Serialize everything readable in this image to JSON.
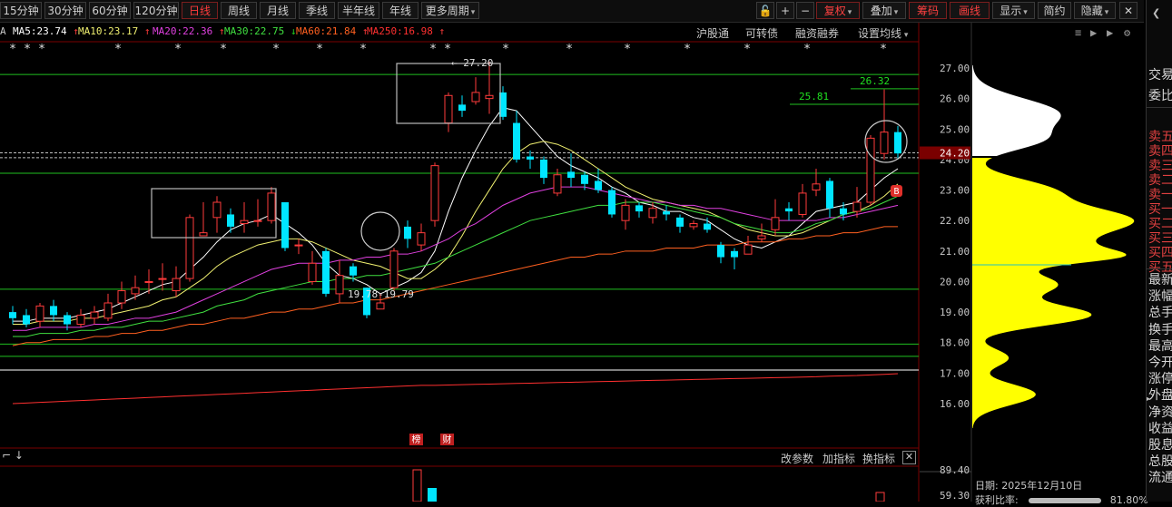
{
  "toolbar": {
    "periods": [
      "15分钟",
      "30分钟",
      "60分钟",
      "120分钟",
      "日线",
      "周线",
      "月线",
      "季线",
      "半年线",
      "年线",
      "更多周期"
    ],
    "active_period": "日线",
    "right_buttons": [
      "复权",
      "叠加",
      "筹码",
      "画线",
      "显示",
      "简约",
      "隐藏"
    ]
  },
  "ma_line": [
    {
      "label": "A",
      "value": "",
      "color": "#c8c8c8"
    },
    {
      "label": "MA5:23.74",
      "arrow": "↑",
      "color": "#ffffff",
      "arrow_color": "#ff3b3b"
    },
    {
      "label": "MA10:23.17",
      "arrow": "↑",
      "color": "#f0f070",
      "arrow_color": "#ff3b3b"
    },
    {
      "label": "MA20:22.36",
      "arrow": "↑",
      "color": "#e040e0",
      "arrow_color": "#ff3b3b"
    },
    {
      "label": "MA30:22.75",
      "arrow": "↓",
      "color": "#40e040",
      "arrow_color": "#20d020"
    },
    {
      "label": "MA60:21.84",
      "arrow": "↑",
      "color": "#ff6020",
      "arrow_color": "#ff3b3b"
    },
    {
      "label": "MA250:16.98",
      "arrow": "↑",
      "color": "#ff3030",
      "arrow_color": "#ff3b3b"
    }
  ],
  "top_links": [
    "沪股通",
    "可转债",
    "融资融券",
    "设置均线"
  ],
  "indicator_links": [
    "改参数",
    "加指标",
    "换指标"
  ],
  "price_axis": [
    "27.00",
    "26.00",
    "25.00",
    "24.00",
    "23.00",
    "22.00",
    "21.00",
    "20.00",
    "19.00",
    "18.00",
    "17.00",
    "16.00"
  ],
  "current_price": "24.20",
  "volume_axis": [
    "89.40",
    "59.30"
  ],
  "annotations": {
    "high_label": "27.20",
    "low_label": "19.78-19.79",
    "level_1": "25.81",
    "level_2": "26.32",
    "badge_b": "B",
    "tag_bang": "榜",
    "tag_cai": "财"
  },
  "side_panel": {
    "top_labels": [
      "交易",
      "委比"
    ],
    "order_labels": [
      "卖五",
      "卖四",
      "卖三",
      "卖二",
      "卖一",
      "买一",
      "买二",
      "买三",
      "买四",
      "买五"
    ],
    "stat_labels": [
      "最新",
      "涨幅",
      "总手",
      "换手",
      "最高",
      "今开",
      "涨停",
      "外盘",
      "净资",
      "收益",
      "股息",
      "总股",
      "流通"
    ]
  },
  "status": {
    "date": "日期: 2025年12月10日",
    "ratio_label": "获利比率:",
    "ratio_value": "81.80%"
  },
  "colors": {
    "up": "#ff3b3b",
    "down": "#00e5ff",
    "accent_red": "#e0302a",
    "grid": "#7a0000"
  },
  "chart_data": {
    "type": "candlestick",
    "ylim": [
      15.0,
      27.5
    ],
    "candles": [
      {
        "o": 19.0,
        "c": 18.8,
        "h": 19.2,
        "l": 18.6
      },
      {
        "o": 18.9,
        "c": 18.6,
        "h": 19.1,
        "l": 18.5
      },
      {
        "o": 18.7,
        "c": 19.2,
        "h": 19.3,
        "l": 18.5
      },
      {
        "o": 19.2,
        "c": 18.9,
        "h": 19.4,
        "l": 18.7
      },
      {
        "o": 18.9,
        "c": 18.6,
        "h": 19.0,
        "l": 18.4
      },
      {
        "o": 18.6,
        "c": 18.9,
        "h": 19.1,
        "l": 18.5
      },
      {
        "o": 18.8,
        "c": 19.0,
        "h": 19.2,
        "l": 18.6
      },
      {
        "o": 18.8,
        "c": 19.3,
        "h": 19.6,
        "l": 18.7
      },
      {
        "o": 19.3,
        "c": 19.7,
        "h": 20.0,
        "l": 19.1
      },
      {
        "o": 19.6,
        "c": 19.8,
        "h": 20.2,
        "l": 19.4
      },
      {
        "o": 20.0,
        "c": 20.0,
        "h": 20.4,
        "l": 19.6
      },
      {
        "o": 20.1,
        "c": 20.1,
        "h": 20.6,
        "l": 19.7
      },
      {
        "o": 19.7,
        "c": 20.1,
        "h": 20.5,
        "l": 19.5
      },
      {
        "o": 20.1,
        "c": 22.1,
        "h": 22.2,
        "l": 20.0
      },
      {
        "o": 21.5,
        "c": 21.6,
        "h": 22.6,
        "l": 21.5
      },
      {
        "o": 22.1,
        "c": 22.6,
        "h": 22.8,
        "l": 21.6
      },
      {
        "o": 22.2,
        "c": 21.8,
        "h": 22.4,
        "l": 21.6
      },
      {
        "o": 21.9,
        "c": 22.0,
        "h": 22.6,
        "l": 21.6
      },
      {
        "o": 22.0,
        "c": 22.0,
        "h": 22.7,
        "l": 21.8
      },
      {
        "o": 22.0,
        "c": 22.9,
        "h": 23.1,
        "l": 21.9
      },
      {
        "o": 22.6,
        "c": 21.1,
        "h": 22.6,
        "l": 21.0
      },
      {
        "o": 21.2,
        "c": 21.2,
        "h": 21.4,
        "l": 20.9
      },
      {
        "o": 20.0,
        "c": 20.6,
        "h": 21.0,
        "l": 19.9
      },
      {
        "o": 21.0,
        "c": 19.6,
        "h": 21.1,
        "l": 19.5
      },
      {
        "o": 19.6,
        "c": 20.2,
        "h": 20.7,
        "l": 19.3
      },
      {
        "o": 20.5,
        "c": 20.2,
        "h": 20.6,
        "l": 20.0
      },
      {
        "o": 19.8,
        "c": 18.9,
        "h": 19.8,
        "l": 18.8
      },
      {
        "o": 19.1,
        "c": 19.3,
        "h": 19.6,
        "l": 19.1
      },
      {
        "o": 19.8,
        "c": 21.0,
        "h": 21.1,
        "l": 19.7
      },
      {
        "o": 21.8,
        "c": 21.4,
        "h": 22.0,
        "l": 21.1
      },
      {
        "o": 21.2,
        "c": 21.6,
        "h": 21.9,
        "l": 21.0
      },
      {
        "o": 22.0,
        "c": 23.8,
        "h": 23.9,
        "l": 21.8
      },
      {
        "o": 25.2,
        "c": 26.1,
        "h": 26.2,
        "l": 24.9
      },
      {
        "o": 25.8,
        "c": 25.6,
        "h": 26.1,
        "l": 25.4
      },
      {
        "o": 25.9,
        "c": 26.2,
        "h": 26.7,
        "l": 25.8
      },
      {
        "o": 26.0,
        "c": 26.1,
        "h": 27.2,
        "l": 25.5
      },
      {
        "o": 26.2,
        "c": 25.4,
        "h": 26.4,
        "l": 25.3
      },
      {
        "o": 25.2,
        "c": 24.0,
        "h": 25.6,
        "l": 23.9
      },
      {
        "o": 24.1,
        "c": 24.0,
        "h": 24.3,
        "l": 23.7
      },
      {
        "o": 24.0,
        "c": 23.4,
        "h": 24.1,
        "l": 23.2
      },
      {
        "o": 22.9,
        "c": 23.5,
        "h": 23.7,
        "l": 22.8
      },
      {
        "o": 23.6,
        "c": 23.4,
        "h": 24.2,
        "l": 23.1
      },
      {
        "o": 23.5,
        "c": 23.2,
        "h": 23.6,
        "l": 23.0
      },
      {
        "o": 23.3,
        "c": 23.0,
        "h": 23.7,
        "l": 22.9
      },
      {
        "o": 23.0,
        "c": 22.2,
        "h": 23.1,
        "l": 22.1
      },
      {
        "o": 22.0,
        "c": 22.5,
        "h": 22.7,
        "l": 21.7
      },
      {
        "o": 22.5,
        "c": 22.3,
        "h": 22.6,
        "l": 22.1
      },
      {
        "o": 22.1,
        "c": 22.4,
        "h": 22.6,
        "l": 21.9
      },
      {
        "o": 22.3,
        "c": 22.2,
        "h": 22.5,
        "l": 22.0
      },
      {
        "o": 22.1,
        "c": 21.8,
        "h": 22.2,
        "l": 21.6
      },
      {
        "o": 21.8,
        "c": 21.9,
        "h": 22.0,
        "l": 21.7
      },
      {
        "o": 21.9,
        "c": 21.7,
        "h": 22.1,
        "l": 21.6
      },
      {
        "o": 21.2,
        "c": 20.8,
        "h": 21.3,
        "l": 20.6
      },
      {
        "o": 21.0,
        "c": 20.8,
        "h": 21.1,
        "l": 20.4
      },
      {
        "o": 20.9,
        "c": 21.2,
        "h": 21.5,
        "l": 20.9
      },
      {
        "o": 21.4,
        "c": 21.5,
        "h": 21.9,
        "l": 21.3
      },
      {
        "o": 21.7,
        "c": 22.1,
        "h": 22.7,
        "l": 21.5
      },
      {
        "o": 22.4,
        "c": 22.3,
        "h": 22.6,
        "l": 22.0
      },
      {
        "o": 22.2,
        "c": 22.9,
        "h": 23.2,
        "l": 22.1
      },
      {
        "o": 23.0,
        "c": 23.2,
        "h": 23.7,
        "l": 22.8
      },
      {
        "o": 23.3,
        "c": 22.4,
        "h": 23.4,
        "l": 22.1
      },
      {
        "o": 22.4,
        "c": 22.2,
        "h": 22.6,
        "l": 22.0
      },
      {
        "o": 22.3,
        "c": 22.6,
        "h": 23.1,
        "l": 22.1
      },
      {
        "o": 22.6,
        "c": 24.7,
        "h": 24.8,
        "l": 22.5
      },
      {
        "o": 24.2,
        "c": 24.9,
        "h": 26.3,
        "l": 24.0
      },
      {
        "o": 24.9,
        "c": 24.2,
        "h": 25.1,
        "l": 24.0
      }
    ],
    "ma_series": [
      {
        "name": "MA5",
        "color": "#ffffff",
        "values": [
          18.7,
          18.7,
          18.8,
          18.8,
          18.8,
          18.9,
          19.0,
          19.1,
          19.3,
          19.5,
          19.7,
          19.9,
          20.0,
          20.4,
          20.8,
          21.3,
          21.7,
          21.9,
          22.0,
          22.2,
          21.9,
          21.6,
          21.2,
          20.6,
          20.2,
          20.1,
          19.9,
          19.6,
          19.8,
          20.0,
          20.3,
          21.0,
          22.3,
          23.4,
          24.3,
          25.1,
          25.7,
          25.6,
          25.1,
          24.6,
          24.1,
          23.8,
          23.6,
          23.4,
          23.1,
          22.9,
          22.6,
          22.5,
          22.3,
          22.3,
          22.1,
          22.0,
          21.7,
          21.4,
          21.2,
          21.1,
          21.3,
          21.5,
          21.9,
          22.3,
          22.4,
          22.5,
          22.6,
          23.0,
          23.4,
          23.7
        ]
      },
      {
        "name": "MA10",
        "color": "#f0f070",
        "values": [
          18.6,
          18.6,
          18.7,
          18.7,
          18.7,
          18.8,
          18.8,
          18.9,
          19.0,
          19.1,
          19.2,
          19.4,
          19.5,
          19.8,
          20.1,
          20.5,
          20.8,
          21.0,
          21.2,
          21.3,
          21.4,
          21.4,
          21.3,
          21.1,
          20.9,
          20.7,
          20.6,
          20.5,
          20.3,
          20.1,
          20.1,
          20.4,
          20.8,
          21.5,
          22.3,
          23.0,
          23.7,
          24.2,
          24.5,
          24.6,
          24.5,
          24.3,
          24.0,
          23.7,
          23.4,
          23.1,
          22.9,
          22.7,
          22.6,
          22.5,
          22.4,
          22.3,
          22.1,
          21.9,
          21.7,
          21.6,
          21.5,
          21.5,
          21.6,
          21.8,
          22.0,
          22.2,
          22.3,
          22.5,
          22.8,
          23.2
        ]
      },
      {
        "name": "MA20",
        "color": "#e040e0",
        "values": [
          18.4,
          18.4,
          18.5,
          18.5,
          18.5,
          18.5,
          18.6,
          18.6,
          18.7,
          18.8,
          18.8,
          18.9,
          19.0,
          19.2,
          19.4,
          19.6,
          19.8,
          20.0,
          20.2,
          20.4,
          20.5,
          20.6,
          20.6,
          20.6,
          20.7,
          20.7,
          20.8,
          20.8,
          20.9,
          20.9,
          21.0,
          21.2,
          21.4,
          21.7,
          21.9,
          22.2,
          22.5,
          22.7,
          22.9,
          23.0,
          23.1,
          23.1,
          23.1,
          23.0,
          22.9,
          22.8,
          22.7,
          22.6,
          22.6,
          22.5,
          22.5,
          22.4,
          22.4,
          22.3,
          22.2,
          22.1,
          22.0,
          22.0,
          22.0,
          22.0,
          22.1,
          22.1,
          22.2,
          22.3,
          22.4,
          22.5
        ]
      },
      {
        "name": "MA30",
        "color": "#40e040",
        "values": [
          18.2,
          18.2,
          18.3,
          18.3,
          18.3,
          18.4,
          18.4,
          18.5,
          18.5,
          18.6,
          18.7,
          18.7,
          18.8,
          18.9,
          19.0,
          19.2,
          19.3,
          19.4,
          19.6,
          19.7,
          19.8,
          19.9,
          20.0,
          20.0,
          20.1,
          20.1,
          20.2,
          20.2,
          20.3,
          20.4,
          20.5,
          20.6,
          20.8,
          21.0,
          21.2,
          21.4,
          21.6,
          21.8,
          22.0,
          22.1,
          22.2,
          22.3,
          22.4,
          22.5,
          22.5,
          22.6,
          22.6,
          22.6,
          22.5,
          22.4,
          22.3,
          22.2,
          22.1,
          21.9,
          21.8,
          21.7,
          21.6,
          21.6,
          21.7,
          21.9,
          22.0,
          22.2,
          22.3,
          22.4,
          22.6,
          22.8
        ]
      },
      {
        "name": "MA60",
        "color": "#ff6020",
        "values": [
          17.9,
          18.0,
          18.0,
          18.1,
          18.1,
          18.1,
          18.2,
          18.2,
          18.3,
          18.3,
          18.4,
          18.4,
          18.5,
          18.6,
          18.6,
          18.7,
          18.8,
          18.8,
          18.9,
          19.0,
          19.0,
          19.1,
          19.1,
          19.2,
          19.3,
          19.3,
          19.4,
          19.4,
          19.5,
          19.6,
          19.7,
          19.8,
          19.9,
          20.0,
          20.1,
          20.2,
          20.3,
          20.4,
          20.5,
          20.6,
          20.7,
          20.8,
          20.8,
          20.9,
          20.9,
          21.0,
          21.0,
          21.0,
          21.1,
          21.1,
          21.1,
          21.2,
          21.2,
          21.2,
          21.3,
          21.3,
          21.3,
          21.4,
          21.4,
          21.5,
          21.5,
          21.6,
          21.6,
          21.7,
          21.8,
          21.8
        ]
      },
      {
        "name": "MA250",
        "color": "#ff3030",
        "values": [
          16.0,
          16.02,
          16.04,
          16.06,
          16.08,
          16.1,
          16.12,
          16.14,
          16.16,
          16.18,
          16.2,
          16.22,
          16.24,
          16.26,
          16.28,
          16.3,
          16.32,
          16.34,
          16.36,
          16.38,
          16.4,
          16.42,
          16.44,
          16.46,
          16.48,
          16.5,
          16.52,
          16.54,
          16.56,
          16.58,
          16.6,
          16.6,
          16.61,
          16.62,
          16.63,
          16.64,
          16.65,
          16.66,
          16.67,
          16.68,
          16.69,
          16.7,
          16.71,
          16.72,
          16.73,
          16.74,
          16.75,
          16.76,
          16.77,
          16.78,
          16.79,
          16.8,
          16.81,
          16.82,
          16.83,
          16.84,
          16.85,
          16.86,
          16.87,
          16.88,
          16.9,
          16.91,
          16.92,
          16.94,
          16.96,
          16.98
        ]
      }
    ],
    "h_lines": [
      {
        "y": 26.79,
        "color": "#20c020"
      },
      {
        "y": 25.81,
        "color": "#20c020"
      },
      {
        "y": 26.32,
        "color": "#20c020"
      },
      {
        "y": 24.22,
        "color": "#c0c0c0",
        "dashed": true
      },
      {
        "y": 24.06,
        "color": "#c0c0c0",
        "dashed": true
      },
      {
        "y": 23.55,
        "color": "#20c020"
      },
      {
        "y": 19.75,
        "color": "#20c020"
      },
      {
        "y": 17.95,
        "color": "#20c020"
      },
      {
        "y": 17.55,
        "color": "#20c020"
      },
      {
        "y": 17.1,
        "color": "#ffffff"
      }
    ]
  }
}
